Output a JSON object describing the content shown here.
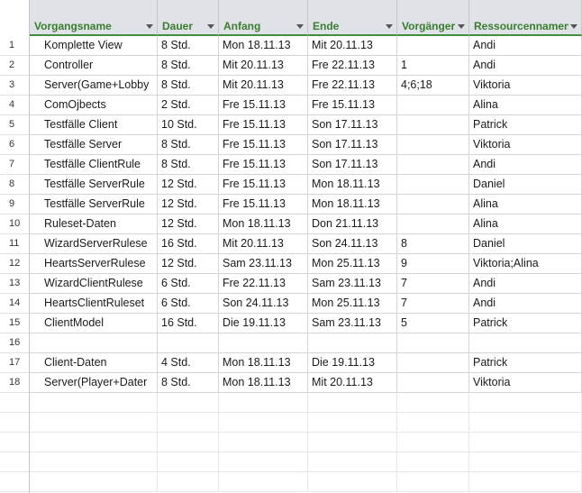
{
  "columns": [
    {
      "key": "name",
      "label": "Vorgangsname"
    },
    {
      "key": "dauer",
      "label": "Dauer"
    },
    {
      "key": "anfang",
      "label": "Anfang"
    },
    {
      "key": "ende",
      "label": "Ende"
    },
    {
      "key": "vorgaenger",
      "label": "Vorgänger"
    },
    {
      "key": "ressourcen",
      "label": "Ressourcennamen"
    }
  ],
  "rows": [
    {
      "num": "1",
      "name": "Komplette View",
      "dauer": "8 Std.",
      "anfang": "Mon 18.11.13",
      "ende": "Mit 20.11.13",
      "vorgaenger": "",
      "ressourcen": "Andi"
    },
    {
      "num": "2",
      "name": "Controller",
      "dauer": "8 Std.",
      "anfang": "Mit 20.11.13",
      "ende": "Fre 22.11.13",
      "vorgaenger": "1",
      "ressourcen": "Andi"
    },
    {
      "num": "3",
      "name": "Server(Game+Lobby",
      "dauer": "8 Std.",
      "anfang": "Mit 20.11.13",
      "ende": "Fre 22.11.13",
      "vorgaenger": "4;6;18",
      "ressourcen": "Viktoria"
    },
    {
      "num": "4",
      "name": "ComOjbects",
      "dauer": "2 Std.",
      "anfang": "Fre 15.11.13",
      "ende": "Fre 15.11.13",
      "vorgaenger": "",
      "ressourcen": "Alina"
    },
    {
      "num": "5",
      "name": "Testfälle Client",
      "dauer": "10 Std.",
      "anfang": "Fre 15.11.13",
      "ende": "Son 17.11.13",
      "vorgaenger": "",
      "ressourcen": "Patrick"
    },
    {
      "num": "6",
      "name": "Testfälle Server",
      "dauer": "8 Std.",
      "anfang": "Fre 15.11.13",
      "ende": "Son 17.11.13",
      "vorgaenger": "",
      "ressourcen": "Viktoria"
    },
    {
      "num": "7",
      "name": "Testfälle ClientRule",
      "dauer": "8 Std.",
      "anfang": "Fre 15.11.13",
      "ende": "Son 17.11.13",
      "vorgaenger": "",
      "ressourcen": "Andi"
    },
    {
      "num": "8",
      "name": "Testfälle ServerRule",
      "dauer": "12 Std.",
      "anfang": "Fre 15.11.13",
      "ende": "Mon 18.11.13",
      "vorgaenger": "",
      "ressourcen": "Daniel"
    },
    {
      "num": "9",
      "name": "Testfälle ServerRule",
      "dauer": "12 Std.",
      "anfang": "Fre 15.11.13",
      "ende": "Mon 18.11.13",
      "vorgaenger": "",
      "ressourcen": "Alina"
    },
    {
      "num": "10",
      "name": "Ruleset-Daten",
      "dauer": "12 Std.",
      "anfang": "Mon 18.11.13",
      "ende": "Don 21.11.13",
      "vorgaenger": "",
      "ressourcen": "Alina"
    },
    {
      "num": "11",
      "name": "WizardServerRulese",
      "dauer": "16 Std.",
      "anfang": "Mit 20.11.13",
      "ende": "Son 24.11.13",
      "vorgaenger": "8",
      "ressourcen": "Daniel"
    },
    {
      "num": "12",
      "name": "HeartsServerRulese",
      "dauer": "12 Std.",
      "anfang": "Sam 23.11.13",
      "ende": "Mon 25.11.13",
      "vorgaenger": "9",
      "ressourcen": "Viktoria;Alina"
    },
    {
      "num": "13",
      "name": "WizardClientRulese",
      "dauer": "6 Std.",
      "anfang": "Fre 22.11.13",
      "ende": "Sam 23.11.13",
      "vorgaenger": "7",
      "ressourcen": "Andi"
    },
    {
      "num": "14",
      "name": "HeartsClientRuleset",
      "dauer": "6 Std.",
      "anfang": "Son 24.11.13",
      "ende": "Mon 25.11.13",
      "vorgaenger": "7",
      "ressourcen": "Andi"
    },
    {
      "num": "15",
      "name": "ClientModel",
      "dauer": "16 Std.",
      "anfang": "Die 19.11.13",
      "ende": "Sam 23.11.13",
      "vorgaenger": "5",
      "ressourcen": "Patrick"
    },
    {
      "num": "16",
      "name": "",
      "dauer": "",
      "anfang": "",
      "ende": "",
      "vorgaenger": "",
      "ressourcen": ""
    },
    {
      "num": "17",
      "name": "Client-Daten",
      "dauer": "4 Std.",
      "anfang": "Mon 18.11.13",
      "ende": "Die 19.11.13",
      "vorgaenger": "",
      "ressourcen": "Patrick"
    },
    {
      "num": "18",
      "name": "Server(Player+Dater",
      "dauer": "8 Std.",
      "anfang": "Mon 18.11.13",
      "ende": "Mit 20.11.13",
      "vorgaenger": "",
      "ressourcen": "Viktoria"
    }
  ]
}
